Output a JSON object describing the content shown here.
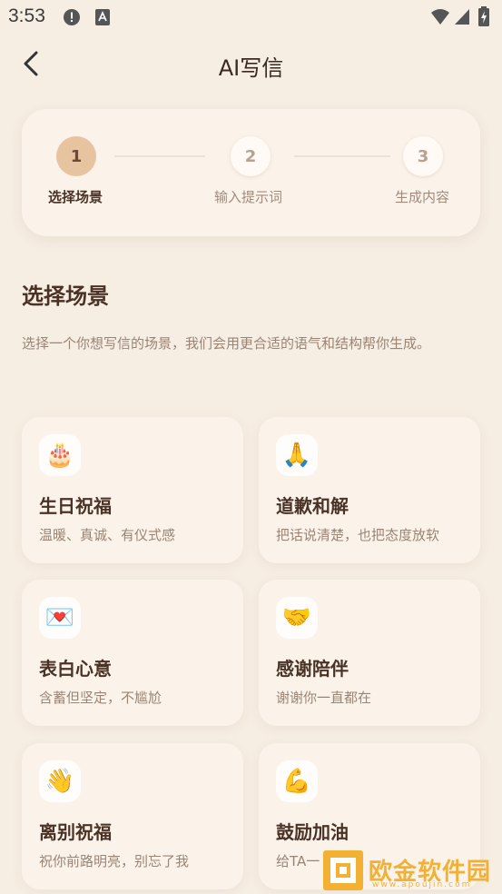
{
  "status_bar": {
    "time": "3:53"
  },
  "header": {
    "title": "AI写信"
  },
  "stepper": {
    "steps": [
      {
        "number": "1",
        "label": "选择场景"
      },
      {
        "number": "2",
        "label": "输入提示词"
      },
      {
        "number": "3",
        "label": "生成内容"
      }
    ],
    "active_step": 1
  },
  "section": {
    "title": "选择场景",
    "description": "选择一个你想写信的场景，我们会用更合适的语气和结构帮你生成。"
  },
  "scenes": [
    {
      "icon": "birthday-cake-icon",
      "emoji": "🎂",
      "title": "生日祝福",
      "subtitle": "温暖、真诚、有仪式感"
    },
    {
      "icon": "folded-hands-icon",
      "emoji": "🙏",
      "title": "道歉和解",
      "subtitle": "把话说清楚，也把态度放软"
    },
    {
      "icon": "love-letter-icon",
      "emoji": "💌",
      "title": "表白心意",
      "subtitle": "含蓄但坚定，不尴尬"
    },
    {
      "icon": "handshake-icon",
      "emoji": "🤝",
      "title": "感谢陪伴",
      "subtitle": "谢谢你一直都在"
    },
    {
      "icon": "waving-hand-icon",
      "emoji": "👋",
      "title": "离别祝福",
      "subtitle": "祝你前路明亮，别忘了我"
    },
    {
      "icon": "flexed-biceps-icon",
      "emoji": "💪",
      "title": "鼓励加油",
      "subtitle": "给TA一"
    }
  ],
  "watermark": {
    "text": "欧金软件园",
    "url": "www.apoujin.com"
  },
  "colors": {
    "background": "#f6ede3",
    "accent": "#e7c3a0",
    "watermark": "#f2b132"
  }
}
